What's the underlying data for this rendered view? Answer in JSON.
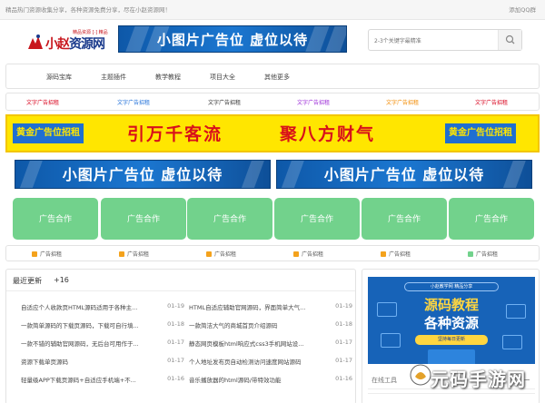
{
  "topbar": {
    "notice": "精品热门资源收集分享，各种资源免费分享，尽在小赵资源网！",
    "qq_link": "添加QQ群"
  },
  "header": {
    "logo_text_red": "小赵",
    "logo_text_blue": "资源网",
    "logo_tag": "精品资源 [·] 精品",
    "banner_text": "小图片广告位 虚位以待",
    "search_placeholder": "2-3个关键字最精准"
  },
  "nav": {
    "items": [
      "源码宝库",
      "主题插件",
      "教学教程",
      "项目大全",
      "其他更多"
    ]
  },
  "text_ads": {
    "label": "文字广告招租",
    "colors": [
      "#d9001b",
      "#1e6fd9",
      "#333333",
      "#9b2bd8",
      "#f28a00",
      "#d9001b"
    ]
  },
  "gold_banner": {
    "badge_label": "黄金广告位招租",
    "slogan_left": "引万千客流",
    "slogan_right": "聚八方财气"
  },
  "two_banners": [
    "小图片广告位 虚位以待",
    "小图片广告位 虚位以待"
  ],
  "green_ads": [
    "广告合作",
    "广告合作",
    "广告合作",
    "广告合作",
    "广告合作",
    "广告合作"
  ],
  "small_ads": {
    "label": "广告招租",
    "count": 6
  },
  "updates": {
    "title": "最近更新",
    "count": "+16",
    "left": [
      {
        "name": "自适应个人收款页HTML源码适用于各种主...",
        "date": "01-19"
      },
      {
        "name": "一款简单源码的下载页源码，下载可自行填...",
        "date": "01-18"
      },
      {
        "name": "一款不错的辅助官网源码，无后台可用作于...",
        "date": "01-17"
      },
      {
        "name": "资源下载单页源码",
        "date": "01-17"
      },
      {
        "name": "轻量级APP下载页源码+自适应手机端+不...",
        "date": "01-16"
      }
    ],
    "right": [
      {
        "name": "HTML自适应辅助官网源码，界面简单大气...",
        "date": "01-19"
      },
      {
        "name": "一款简洁大气的商城首页介绍源码",
        "date": "01-18"
      },
      {
        "name": "静态网页模板html响应式css3手机网站设...",
        "date": "01-17"
      },
      {
        "name": "个人地址发布页自动检测访问速度网站源码",
        "date": "01-17"
      },
      {
        "name": "音乐播放器的html源码/带特效功能",
        "date": "01-16"
      }
    ]
  },
  "side": {
    "promo_top": "小赵教学网 精品分享",
    "promo_line1": "源码教程",
    "promo_line2": "各种资源",
    "promo_cta": "坚持每日更新",
    "tools_title": "在线工具"
  },
  "watermark": "元码手游网",
  "colors": {
    "banner_blue": "#1b77d1",
    "gold": "#ffe600",
    "green": "#72d28c",
    "red": "#d8101a"
  }
}
